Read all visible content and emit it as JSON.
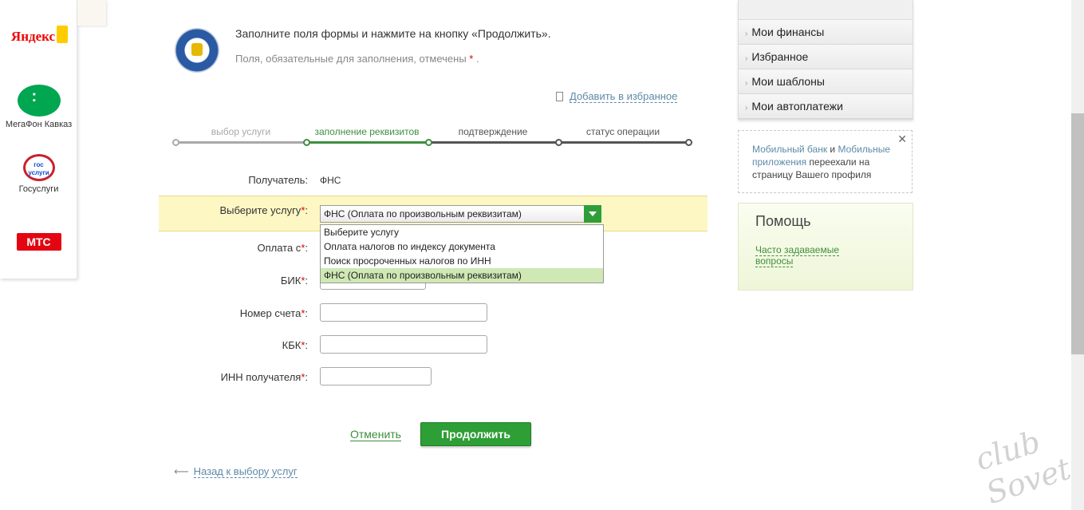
{
  "sidebar": {
    "yandex": "Яндекс",
    "megafon": "МегаФон Кавказ",
    "gosuslugi_logo": "гос услуги",
    "gosuslugi": "Госуслуги",
    "mts": "МТС"
  },
  "header": {
    "intro": "Заполните поля формы и нажмите на кнопку «Продолжить».",
    "required_note": "Поля, обязательные для заполнения, отмечены",
    "required_star": "*",
    "required_dot": ".",
    "favorite": "Добавить в избранное"
  },
  "steps": [
    {
      "label": "выбор услуги",
      "color": "#a9a9a9"
    },
    {
      "label": "заполнение реквизитов",
      "color": "#3f8e3f"
    },
    {
      "label": "подтверждение",
      "color": "#555555"
    },
    {
      "label": "статус операции",
      "color": "#555555"
    }
  ],
  "form": {
    "recipient_label": "Получатель:",
    "recipient_value": "ФНС",
    "service_label": "Выберите услугу",
    "service_selected": "ФНС (Оплата по произвольным реквизитам)",
    "service_options": [
      "Выберите услугу",
      "Оплата налогов по индексу документа",
      "Поиск просроченных налогов по ИНН",
      "ФНС (Оплата по произвольным реквизитам)"
    ],
    "pay_from_label": "Оплата с",
    "bik_label": "БИК",
    "account_label": "Номер счета",
    "kbk_label": "КБК",
    "inn_label": "ИНН получателя",
    "star": "*",
    "colon": ":"
  },
  "actions": {
    "cancel": "Отменить",
    "continue": "Продолжить",
    "back": "Назад к выбору услуг"
  },
  "right_menu": {
    "items": [
      "Мои финансы",
      "Избранное",
      "Мои шаблоны",
      "Мои автоплатежи"
    ]
  },
  "notice": {
    "link1": "Мобильный банк",
    "and": " и ",
    "link2": "Мобильные приложения",
    "text": " переехали на страницу Вашего профиля"
  },
  "help": {
    "title": "Помощь",
    "faq": "Часто задаваемые вопросы"
  },
  "watermark": "club Sovet",
  "colors": {
    "accent_green": "#2e9e36",
    "highlight": "#fdf7c4",
    "required_star": "#dd0000",
    "link_blue": "#5d8aa8"
  }
}
